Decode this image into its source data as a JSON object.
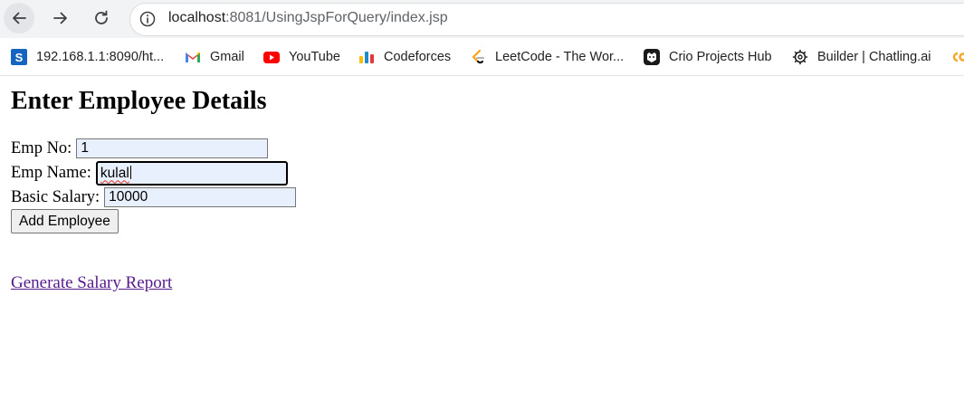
{
  "browser": {
    "url_host": "localhost",
    "url_rest": ":8081/UsingJspForQuery/index.jsp"
  },
  "bookmarks": [
    {
      "label": "192.168.1.1:8090/ht...",
      "icon": "s-box-icon",
      "color": "#1565c0"
    },
    {
      "label": "Gmail",
      "icon": "gmail-icon",
      "color": "#ea4335"
    },
    {
      "label": "YouTube",
      "icon": "youtube-icon",
      "color": "#ff0000"
    },
    {
      "label": "Codeforces",
      "icon": "codeforces-icon",
      "color": "#1f8acb"
    },
    {
      "label": "LeetCode - The Wor...",
      "icon": "leetcode-icon",
      "color": "#ffa116"
    },
    {
      "label": "Crio Projects Hub",
      "icon": "crio-icon",
      "color": "#000000"
    },
    {
      "label": "Builder | Chatling.ai",
      "icon": "gear-icon",
      "color": "#202124"
    }
  ],
  "page": {
    "title": "Enter Employee Details",
    "emp_no_label": "Emp No:",
    "emp_no_value": "1",
    "emp_name_label": "Emp Name:",
    "emp_name_value": "kulal",
    "salary_label": "Basic Salary:",
    "salary_value": "10000",
    "add_button": "Add Employee",
    "report_link": "Generate Salary Report"
  }
}
